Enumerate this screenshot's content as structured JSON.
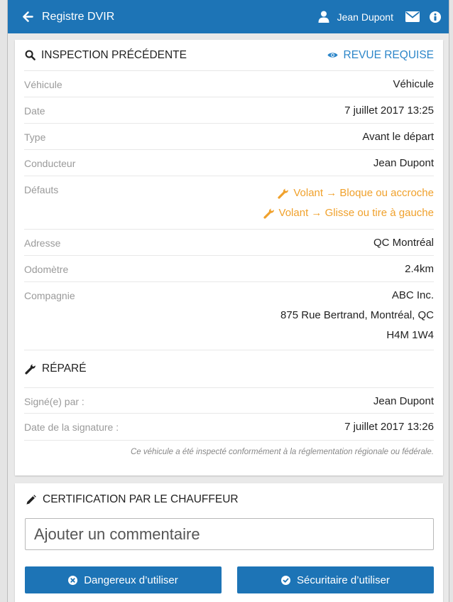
{
  "header": {
    "title": "Registre DVIR",
    "user_name": "Jean Dupont",
    "background_color": "#1d74b6",
    "icons": [
      "arrow-left-icon",
      "user-icon",
      "envelope-icon",
      "info-icon"
    ]
  },
  "inspection": {
    "title": "INSPECTION PRÉCÉDENTE",
    "review_label": "REVUE REQUISE",
    "rows": {
      "vehicle": {
        "label": "Véhicule",
        "value": "Véhicule"
      },
      "date": {
        "label": "Date",
        "value": "7 juillet 2017 13:25"
      },
      "type": {
        "label": "Type",
        "value": "Avant le départ"
      },
      "driver": {
        "label": "Conducteur",
        "value": "Jean Dupont"
      },
      "defects": {
        "label": "Défauts",
        "items": [
          "Volant → Bloque ou accroche",
          "Volant → Glisse ou tire à gauche"
        ]
      },
      "address": {
        "label": "Adresse",
        "value": "QC Montréal"
      },
      "odometer": {
        "label": "Odomètre",
        "value": "2.4km"
      },
      "company": {
        "label": "Compagnie",
        "lines": [
          "ABC Inc.",
          "875 Rue Bertrand, Montréal, QC",
          "H4M 1W4"
        ]
      }
    },
    "repaired": {
      "title": "RÉPARÉ",
      "signed_by": {
        "label": "Signé(e) par :",
        "value": "Jean Dupont"
      },
      "signature_date": {
        "label": "Date de la signature :",
        "value": "7 juillet 2017 13:26"
      }
    },
    "compliance_note": "Ce véhicule a été inspecté conformément à la réglementation régionale ou fédérale."
  },
  "certification": {
    "title": "CERTIFICATION PAR LE CHAUFFEUR",
    "comment_placeholder": "Ajouter un commentaire",
    "unsafe_label": "Dangereux d’utiliser",
    "safe_label": "Sécuritaire d’utiliser"
  },
  "colors": {
    "accent": "#1d74b6",
    "link": "#2c86c9",
    "defect": "#f0a12c"
  }
}
